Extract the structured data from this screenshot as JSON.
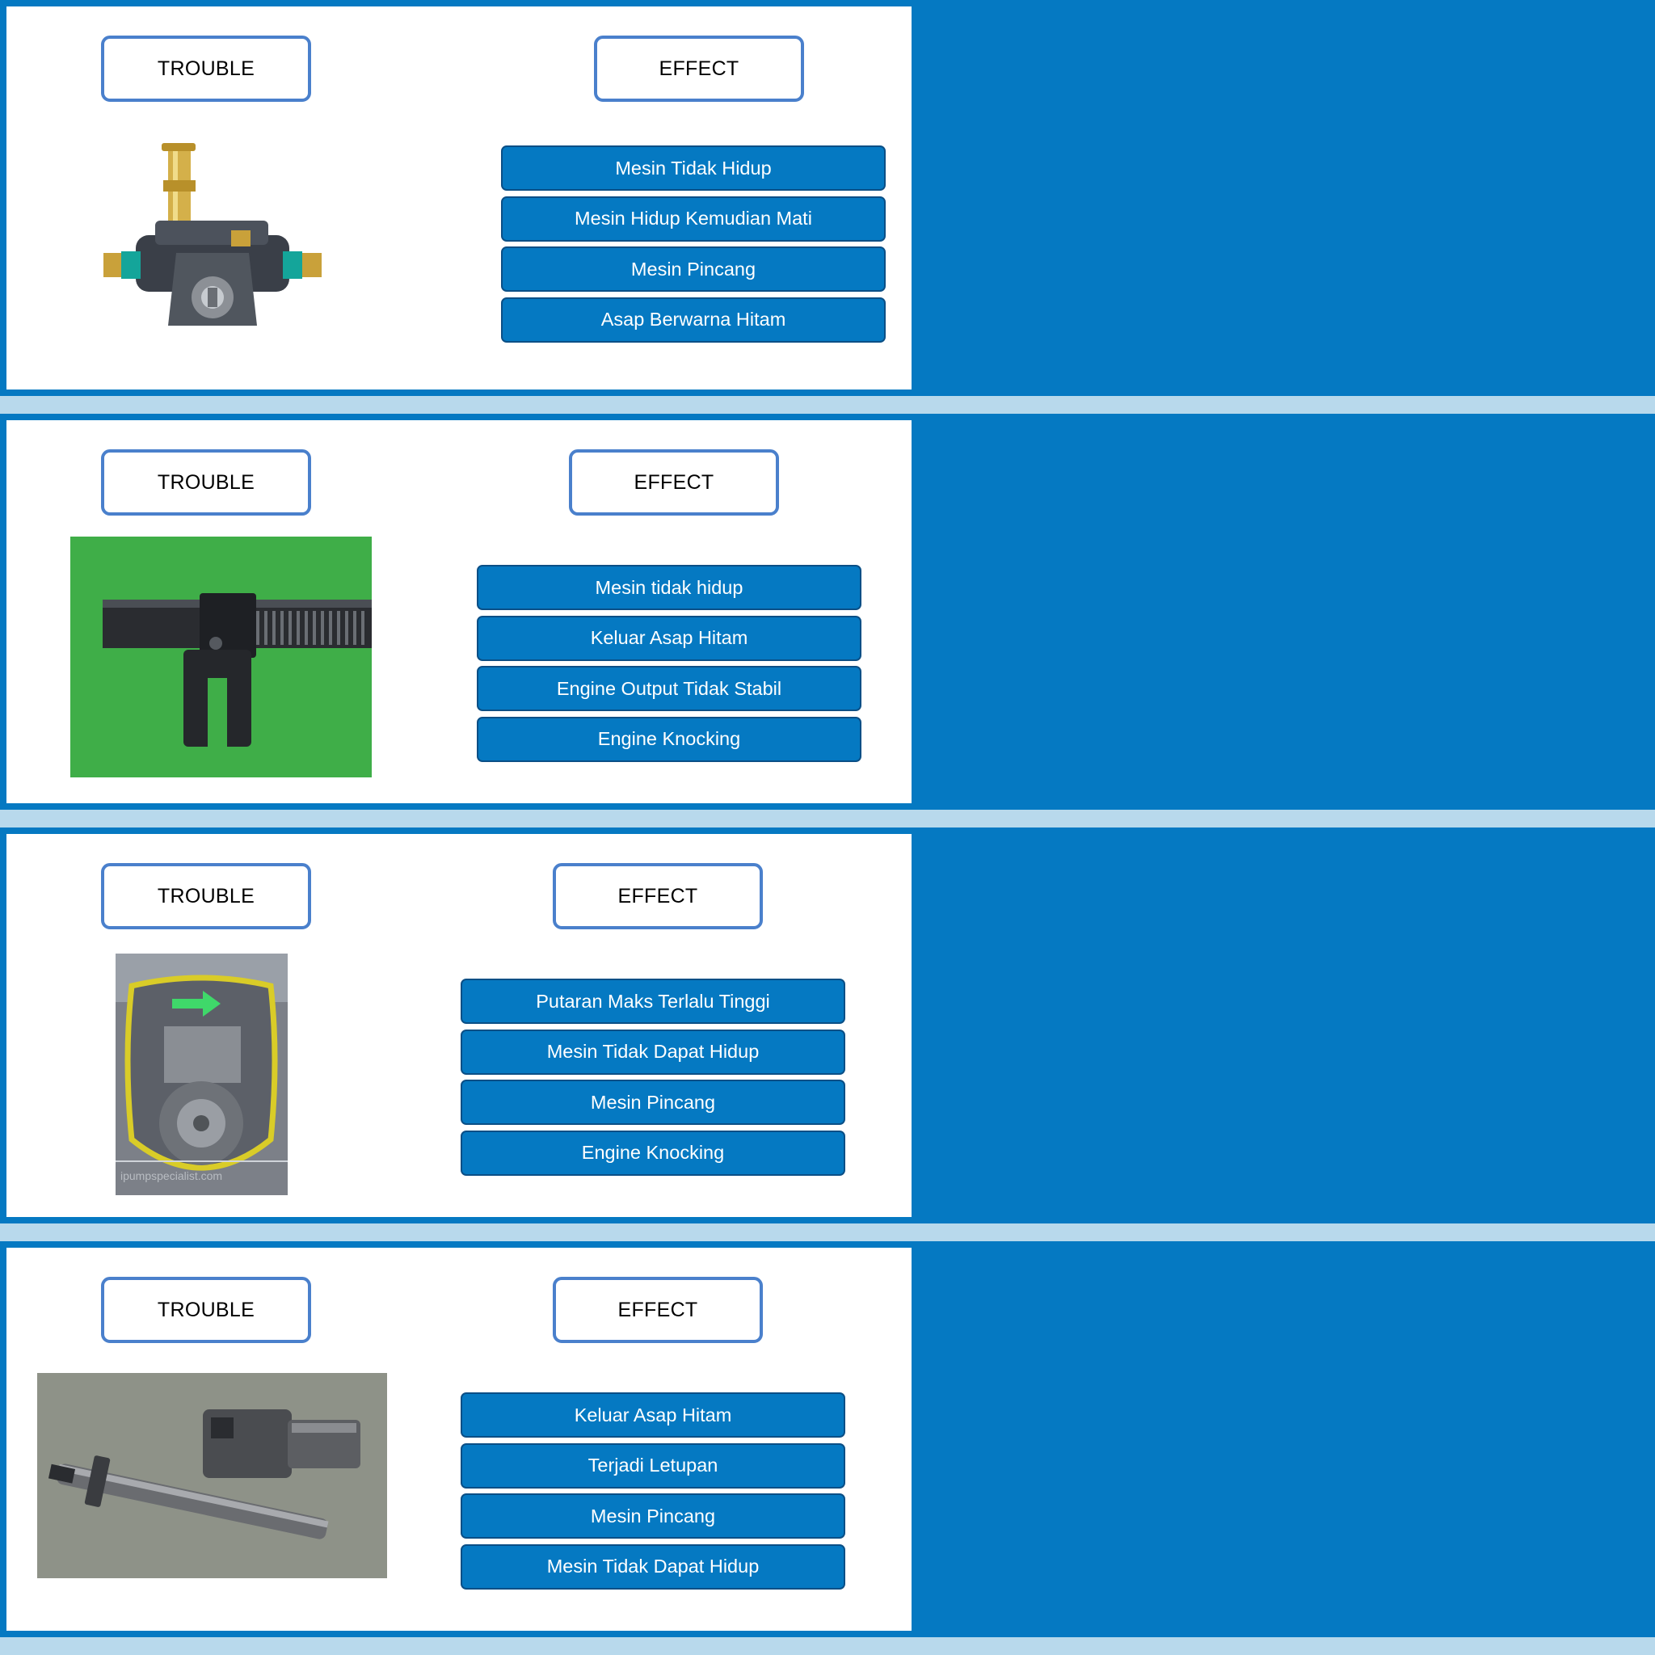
{
  "sections": [
    {
      "trouble_label": "TROUBLE",
      "effect_label": "EFFECT",
      "image": "feed-pump-photo",
      "effects": [
        "Mesin Tidak Hidup",
        "Mesin Hidup Kemudian Mati",
        "Mesin Pincang",
        "Asap Berwarna Hitam"
      ]
    },
    {
      "trouble_label": "TROUBLE",
      "effect_label": "EFFECT",
      "image": "control-rack-photo",
      "effects": [
        "Mesin tidak hidup",
        "Keluar Asap Hitam",
        "Engine Output Tidak Stabil",
        "Engine Knocking"
      ]
    },
    {
      "trouble_label": "TROUBLE",
      "effect_label": "EFFECT",
      "image": "pump-housing-photo",
      "image_watermark": "ipumpspecialist.com",
      "effects": [
        "Putaran Maks Terlalu Tinggi",
        "Mesin Tidak Dapat Hidup",
        "Mesin Pincang",
        "Engine Knocking"
      ]
    },
    {
      "trouble_label": "TROUBLE",
      "effect_label": "EFFECT",
      "image": "plunger-barrel-photo",
      "effects": [
        "Keluar Asap Hitam",
        "Terjadi Letupan",
        "Mesin Pincang",
        "Mesin Tidak Dapat Hidup"
      ]
    }
  ],
  "colors": {
    "band_blue": "#0579c2",
    "separator": "#b8d9ec",
    "header_border": "#4a80cc",
    "button_border": "#0b4f86"
  }
}
